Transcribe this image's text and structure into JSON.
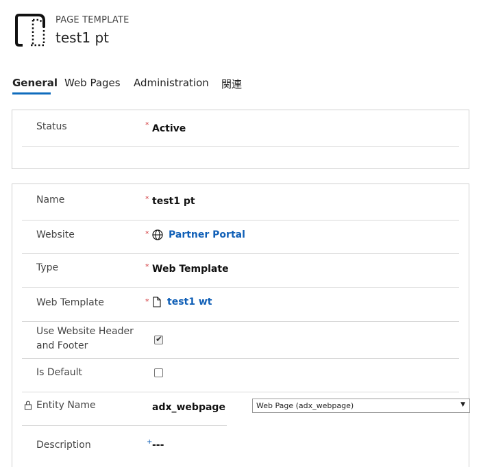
{
  "header": {
    "entity_type": "PAGE TEMPLATE",
    "record_title": "test1 pt",
    "icon": "document-icon"
  },
  "tabs": [
    {
      "label": "General",
      "active": true
    },
    {
      "label": "Web Pages"
    },
    {
      "label": "Administration"
    },
    {
      "label": "関連"
    }
  ],
  "status_section": {
    "status": {
      "label": "Status",
      "required": "*",
      "value": "Active"
    }
  },
  "main_section": {
    "name": {
      "label": "Name",
      "required": "*",
      "value": "test1 pt"
    },
    "website": {
      "label": "Website",
      "required": "*",
      "value": "Partner Portal",
      "icon": "globe-icon"
    },
    "type": {
      "label": "Type",
      "required": "*",
      "value": "Web Template"
    },
    "web_template": {
      "label": "Web Template",
      "required": "*",
      "value": "test1 wt",
      "icon": "document-icon"
    },
    "use_header_footer": {
      "label_line1": "Use Website Header",
      "label_line2": "and Footer",
      "checked": true
    },
    "is_default": {
      "label": "Is Default",
      "checked": false
    },
    "entity_name": {
      "label": "Entity Name",
      "value": "adx_webpage",
      "select_value": "Web Page (adx_webpage)",
      "icon": "lock-icon"
    },
    "description": {
      "label": "Description",
      "required": "+",
      "value": "---"
    }
  },
  "colors": {
    "accent": "#0f6cbd",
    "link": "#1160b7",
    "required": "#d13438"
  }
}
